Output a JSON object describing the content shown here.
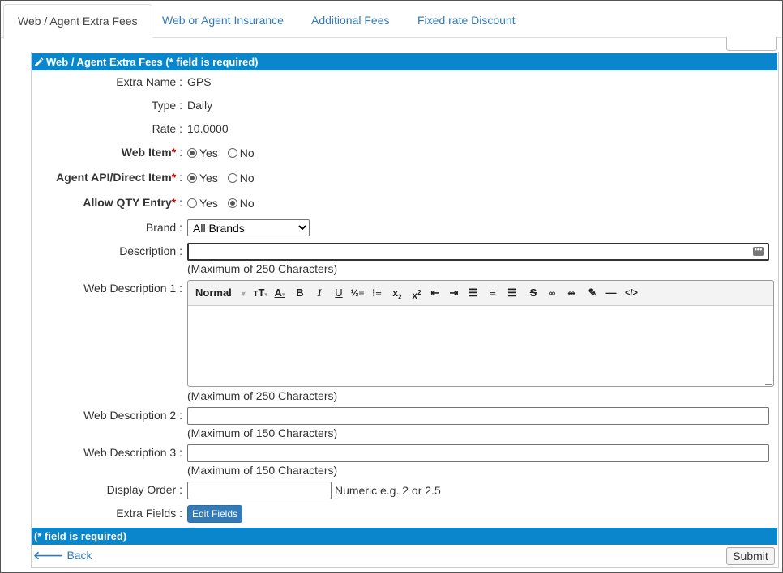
{
  "tabs": [
    {
      "label": "Web / Agent Extra Fees"
    },
    {
      "label": "Web or Agent Insurance"
    },
    {
      "label": "Additional Fees"
    },
    {
      "label": "Fixed rate Discount"
    }
  ],
  "panel": {
    "header": "Web / Agent Extra Fees (* field is required)",
    "footer": "(* field is required)"
  },
  "fields": {
    "extra_name": {
      "label": "Extra Name :",
      "value": "GPS"
    },
    "type": {
      "label": "Type :",
      "value": "Daily"
    },
    "rate": {
      "label": "Rate :",
      "value": "10.0000"
    },
    "web_item": {
      "label": "Web Item",
      "suffix": " :",
      "yes": "Yes",
      "no": "No",
      "selected": "Yes"
    },
    "agent_api": {
      "label": "Agent API/Direct Item",
      "suffix": " :",
      "yes": "Yes",
      "no": "No",
      "selected": "Yes"
    },
    "allow_qty": {
      "label": "Allow QTY Entry",
      "suffix": " :",
      "yes": "Yes",
      "no": "No",
      "selected": "No"
    },
    "brand": {
      "label": "Brand :",
      "value": "All Brands"
    },
    "description": {
      "label": "Description :",
      "value": "",
      "hint": "(Maximum of 250 Characters)"
    },
    "web_desc_1": {
      "label": "Web Description 1 :",
      "hint": "(Maximum of 250 Characters)"
    },
    "web_desc_2": {
      "label": "Web Description 2 :",
      "value": "",
      "hint": "(Maximum of 150 Characters)"
    },
    "web_desc_3": {
      "label": "Web Description 3 :",
      "value": "",
      "hint": "(Maximum of 150 Characters)"
    },
    "display_order": {
      "label": "Display Order :",
      "value": "",
      "hint": "Numeric e.g. 2 or 2.5"
    },
    "extra_fields": {
      "label": "Extra Fields :",
      "button": "Edit Fields"
    }
  },
  "editor": {
    "format": "Normal",
    "tools": [
      "font-size-icon",
      "font-color-icon",
      "bold-icon",
      "italic-icon",
      "underline-icon",
      "ordered-list-icon",
      "unordered-list-icon",
      "subscript-icon",
      "superscript-icon",
      "outdent-icon",
      "indent-icon",
      "align-left-icon",
      "align-center-icon",
      "align-right-icon",
      "strikethrough-icon",
      "link-icon",
      "unlink-icon",
      "eraser-icon",
      "horizontal-rule-icon",
      "code-view-icon"
    ]
  },
  "actions": {
    "back": "Back",
    "submit": "Submit"
  },
  "colors": {
    "accent": "#0a86cc",
    "link": "#337ab7",
    "required": "#cc0000"
  }
}
